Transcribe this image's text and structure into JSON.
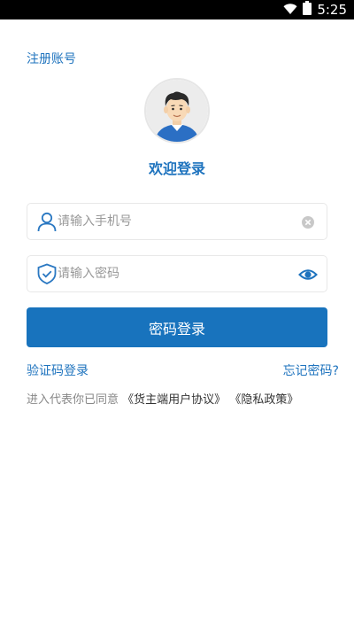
{
  "status_bar": {
    "time": "5:25"
  },
  "header": {
    "register_label": "注册账号"
  },
  "welcome_text": "欢迎登录",
  "phone_field": {
    "placeholder": "请输入手机号",
    "value": ""
  },
  "password_field": {
    "placeholder": "请输入密码",
    "value": ""
  },
  "login_button_label": "密码登录",
  "links": {
    "sms_login": "验证码登录",
    "forgot_password": "忘记密码?"
  },
  "agreement": {
    "prefix": "进入代表你已同意",
    "user_agreement": "《货主端用户协议》",
    "privacy_policy": "《隐私政策》"
  },
  "colors": {
    "accent": "#1e73be",
    "button": "#1873bd",
    "placeholder": "#999999"
  },
  "icons": [
    "wifi-icon",
    "battery-icon",
    "avatar-icon",
    "user-icon",
    "clear-icon",
    "shield-icon",
    "eye-icon"
  ]
}
